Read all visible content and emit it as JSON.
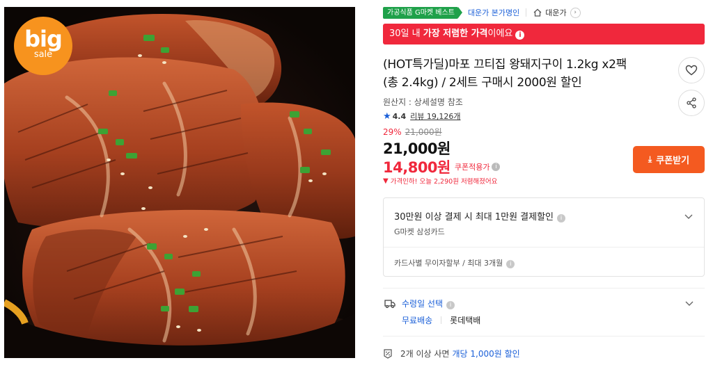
{
  "image": {
    "sale_badge_big": "big",
    "sale_badge_small": "sale"
  },
  "breadcrumb": {
    "badge": "가공식품 G마켓 베스트",
    "seller_link": "대운가 본가명인",
    "store_name": "대운가"
  },
  "banner": {
    "prefix": "30일 내 ",
    "emphasis": "가장 저렴한 가격",
    "suffix": "이에요",
    "info": "i"
  },
  "product": {
    "title_line1": "(HOT특가딜)마포 끄티집 왕돼지구이 1.2kg x2팩",
    "title_line2": "(총 2.4kg) / 2세트 구매시 2000원 할인",
    "origin": "원산지 : 상세설명 참조",
    "rating": "4.4",
    "review_label": "리뷰 19,126개",
    "discount_rate": "29%",
    "original_price": "21,000원",
    "sale_price": "21,000원",
    "coupon_price": "14,800원",
    "coupon_applied_label": "쿠폰적용가",
    "price_drop_text": "가격인하! 오늘 2,290원 저렴해졌어요"
  },
  "actions": {
    "coupon_button": "쿠폰받기"
  },
  "payment": {
    "headline": "30만원 이상 결제 시 최대 1만원 결제할인",
    "card_name": "G마켓 삼성카드",
    "installment": "카드사별 무이자할부 / 최대 3개월"
  },
  "shipping": {
    "title": "수령일 선택",
    "free": "무료배송",
    "carrier": "롯데택배"
  },
  "promo": {
    "prefix": "2개 이상 사면 ",
    "highlight": "개당 1,000원 할인"
  },
  "colors": {
    "accent_red": "#f0283c",
    "coupon_orange": "#f45a20",
    "link_blue": "#1a5fd8",
    "badge_green": "#1fa14a",
    "sale_badge_orange": "#f7931e"
  }
}
